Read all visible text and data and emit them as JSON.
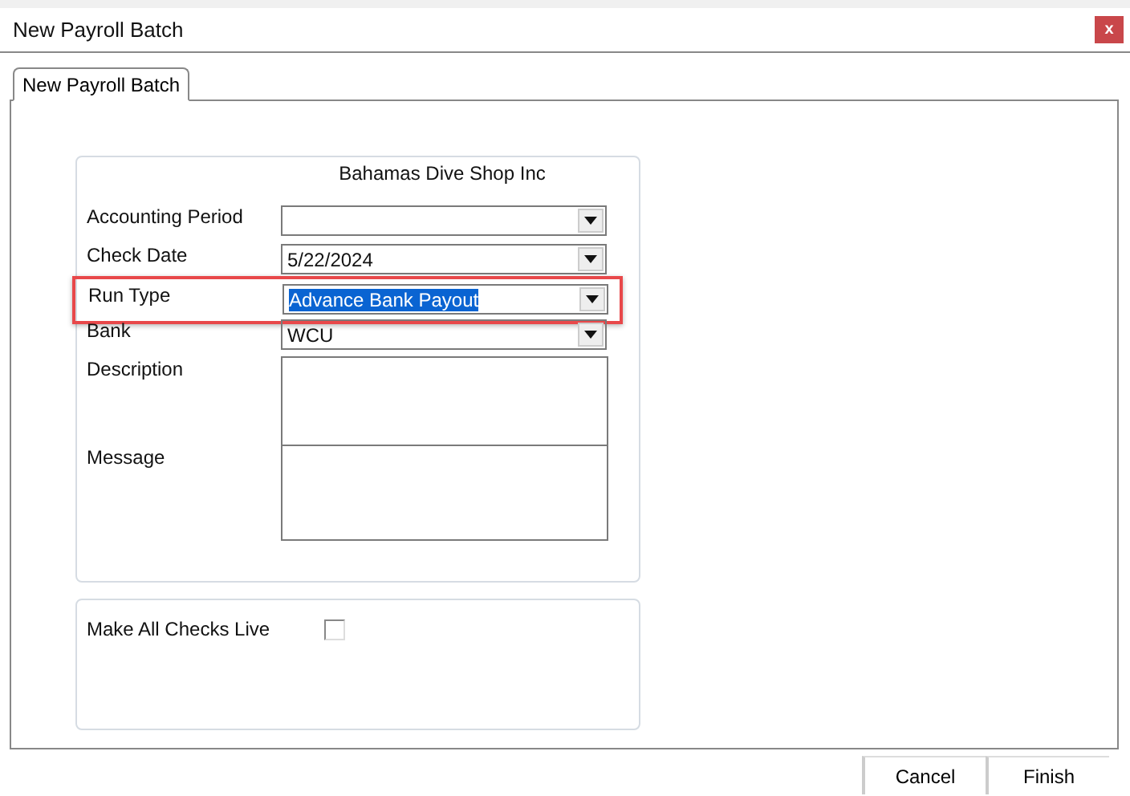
{
  "window": {
    "title": "New Payroll Batch",
    "close": "x"
  },
  "tabs": [
    {
      "label": "New Payroll Batch",
      "selected": true
    }
  ],
  "company": "Bahamas Dive Shop Inc",
  "fields": [
    {
      "kind": "dropdown",
      "label": "Accounting Period"
    },
    {
      "kind": "dropdown",
      "label": "Check Date",
      "value": "5/22/2024"
    },
    {
      "kind": "dropdown",
      "label": "Run Type",
      "value": "Advance Bank Payout",
      "highlighted": true,
      "text_selected": true
    },
    {
      "kind": "dropdown",
      "label": "Bank",
      "value": "WCU"
    },
    {
      "kind": "textarea",
      "label": "Description"
    },
    {
      "kind": "textarea",
      "label": "Message"
    }
  ],
  "options": [
    {
      "label": "Make All Checks Live",
      "checked": false
    }
  ],
  "buttons": [
    "Cancel",
    "Finish"
  ]
}
